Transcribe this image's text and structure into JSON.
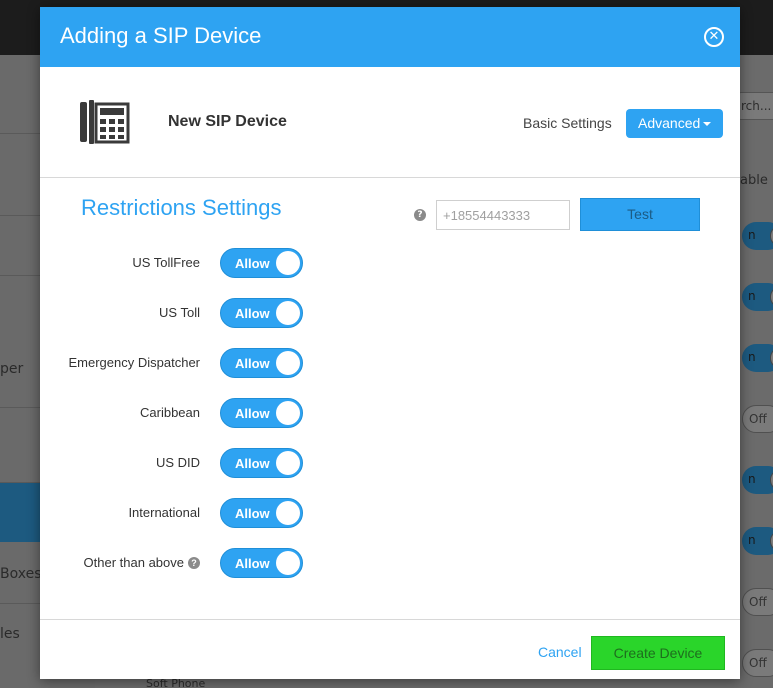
{
  "background": {
    "left_labels": [
      "per",
      "Boxes",
      "les"
    ],
    "search_placeholder": "rch...",
    "column_label": "able",
    "toggle_on_label": "n",
    "toggle_off_label": "Off",
    "bottom_text": "Soft Phone"
  },
  "modal": {
    "title": "Adding a SIP Device",
    "close_icon": "close-circle-icon",
    "device": {
      "icon": "sip-phone-icon",
      "name": "New SIP Device"
    },
    "basic_settings_label": "Basic Settings",
    "advanced_label": "Advanced",
    "section_title": "Restrictions Settings",
    "test": {
      "placeholder": "+18554443333",
      "button_label": "Test"
    },
    "restrictions": [
      {
        "label": "US TollFree",
        "value": "Allow",
        "help": false
      },
      {
        "label": "US Toll",
        "value": "Allow",
        "help": false
      },
      {
        "label": "Emergency Dispatcher",
        "value": "Allow",
        "help": false
      },
      {
        "label": "Caribbean",
        "value": "Allow",
        "help": false
      },
      {
        "label": "US DID",
        "value": "Allow",
        "help": false
      },
      {
        "label": "International",
        "value": "Allow",
        "help": false
      },
      {
        "label": "Other than above",
        "value": "Allow",
        "help": true
      }
    ],
    "footer": {
      "cancel_label": "Cancel",
      "create_label": "Create Device"
    }
  },
  "colors": {
    "primary": "#2ea3f2",
    "success": "#2ad52a"
  }
}
